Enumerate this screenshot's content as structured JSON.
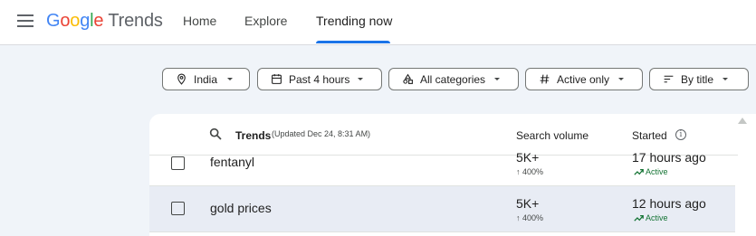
{
  "app": {
    "logo": [
      "G",
      "o",
      "o",
      "g",
      "l",
      "e"
    ],
    "logo_suffix": "Trends"
  },
  "nav": {
    "tabs": [
      {
        "label": "Home"
      },
      {
        "label": "Explore"
      },
      {
        "label": "Trending now"
      }
    ],
    "active_tab": "Trending now"
  },
  "filters": [
    {
      "label": "India",
      "icon": "location-pin-icon"
    },
    {
      "label": "Past 4 hours",
      "icon": "calendar-icon"
    },
    {
      "label": "All categories",
      "icon": "categories-icon"
    },
    {
      "label": "Active only",
      "icon": "hashtag-icon"
    },
    {
      "label": "By title",
      "icon": "sort-icon"
    }
  ],
  "table": {
    "title": "Trends",
    "updated": "(Updated Dec 24, 8:31 AM)",
    "col_volume": "Search volume",
    "col_started": "Started",
    "rows": [
      {
        "title": "fentanyl",
        "volume": "5K+",
        "change": "400%",
        "started": "17 hours ago",
        "status": "Active",
        "checked": false,
        "selected": false
      },
      {
        "title": "gold prices",
        "volume": "5K+",
        "change": "400%",
        "started": "12 hours ago",
        "status": "Active",
        "checked": false,
        "selected": true
      }
    ]
  },
  "colors": {
    "accent": "#1a73e8",
    "active_status": "#137333",
    "selected_row": "#e8ecf4",
    "page_background": "#f0f4f9"
  }
}
